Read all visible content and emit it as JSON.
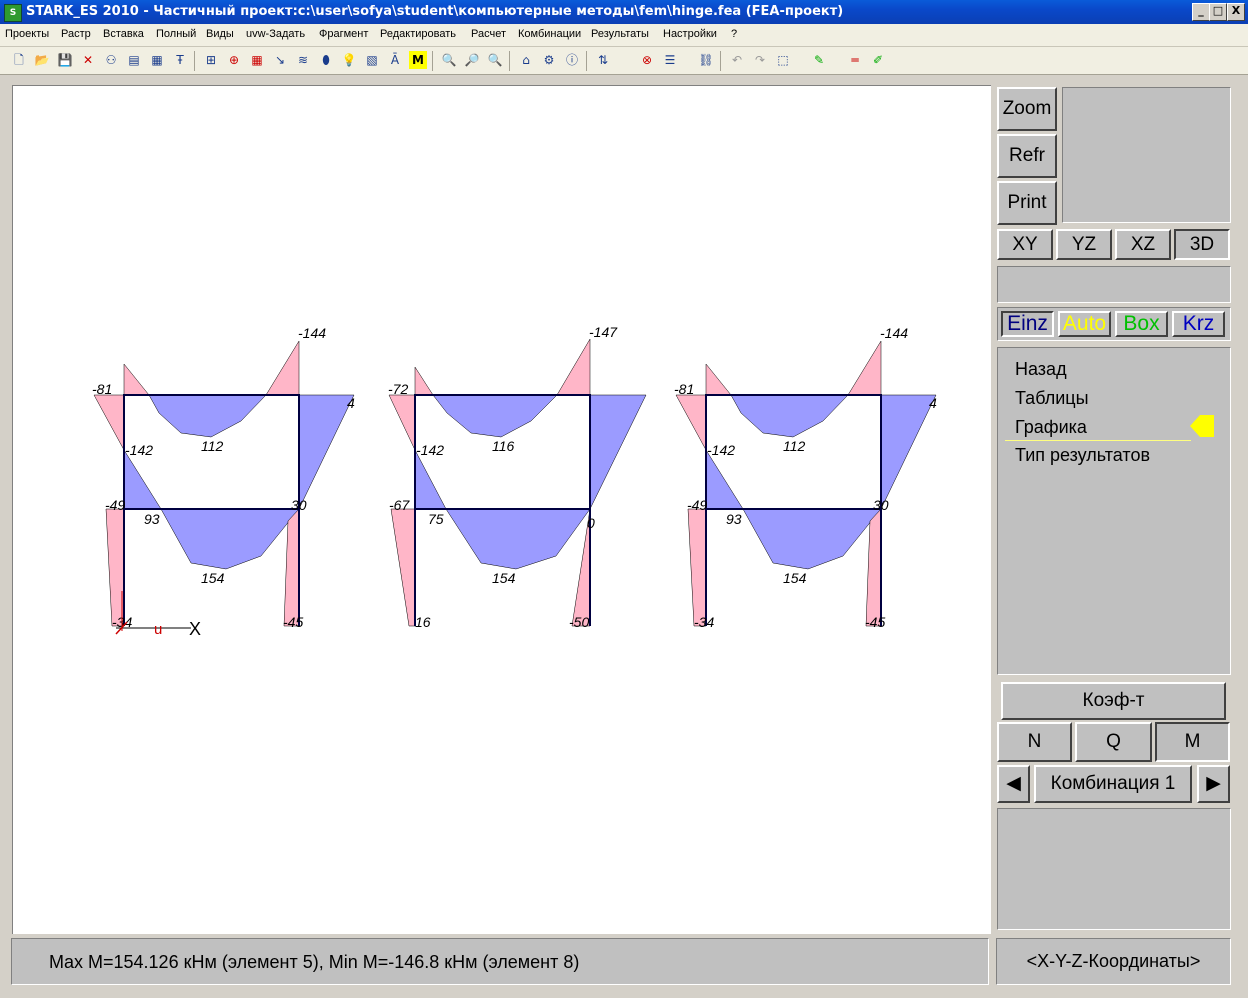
{
  "window": {
    "title": "STARK_ES 2010 - Частичный проект:c:\\user\\sofya\\student\\компьютерные методы\\fem\\hinge.fea  (FEA-проект)",
    "icon": "app-icon",
    "min_label": "_",
    "max_label": "□",
    "close_label": "X"
  },
  "menu": [
    "Проекты",
    "Растр",
    "Вставка",
    "Полный",
    "Виды",
    "uvw-Задать",
    "Фрагмент",
    "Редактировать",
    "Расчет",
    "Комбинации",
    "Результаты",
    "Настройки",
    "?"
  ],
  "toolbar": {
    "icons": [
      "new-file-icon",
      "open-folder-icon",
      "save-icon",
      "delete-icon",
      "nodes-icon",
      "mesh-icon",
      "tablet-icon",
      "db-icon",
      "text-icon",
      "grid-icon",
      "grid-center-icon",
      "grid-fine-icon",
      "axis-icon",
      "layers-icon",
      "cylinder-icon",
      "bulb-icon",
      "numbering-icon",
      "abc-icon",
      "m-icon",
      "zoom-icon",
      "zoom-in-icon",
      "zoom-out-icon",
      "home-icon",
      "properties-icon",
      "info-icon",
      "force-icon",
      "stop-icon",
      "filter-icon",
      "link-icon",
      "undo-icon",
      "redo-icon",
      "view3d-icon",
      "paint-icon",
      "measure-icon",
      "brush-icon"
    ]
  },
  "side": {
    "zoom": "Zoom",
    "refr": "Refr",
    "print": "Print",
    "views": [
      "XY",
      "YZ",
      "XZ",
      "3D"
    ],
    "modes": [
      {
        "label": "Einz",
        "color": "#000080"
      },
      {
        "label": "Auto",
        "color": "#ffff00"
      },
      {
        "label": "Box",
        "color": "#00c000"
      },
      {
        "label": "Krz",
        "color": "#0000ff"
      }
    ],
    "menu_items": [
      "Назад",
      "Таблицы",
      "Графика",
      "Тип результатов"
    ],
    "active_item": "Графика",
    "koef": "Коэф-т",
    "forces": [
      "N",
      "Q",
      "M"
    ],
    "combination": "Комбинация 1",
    "prev": "◀",
    "next": "▶"
  },
  "status": {
    "text": "Max M=154.126 кНм (элемент 5), Min M=-146.8 кНм (элемент 8)",
    "coords": "<X-Y-Z-Координаты>"
  },
  "frames": [
    {
      "labels": [
        "-144",
        "-81",
        "4",
        "-142",
        "112",
        "-49",
        "93",
        "30",
        "154",
        "-34",
        "-45"
      ]
    },
    {
      "labels": [
        "-147",
        "-72",
        "-142",
        "116",
        "-67",
        "75",
        "0",
        "154",
        "16",
        "-50"
      ]
    },
    {
      "labels": [
        "-144",
        "-81",
        "4",
        "-142",
        "112",
        "-49",
        "93",
        "30",
        "154",
        "-34",
        "-45"
      ]
    }
  ],
  "axes": {
    "u": "u",
    "x": "X"
  }
}
